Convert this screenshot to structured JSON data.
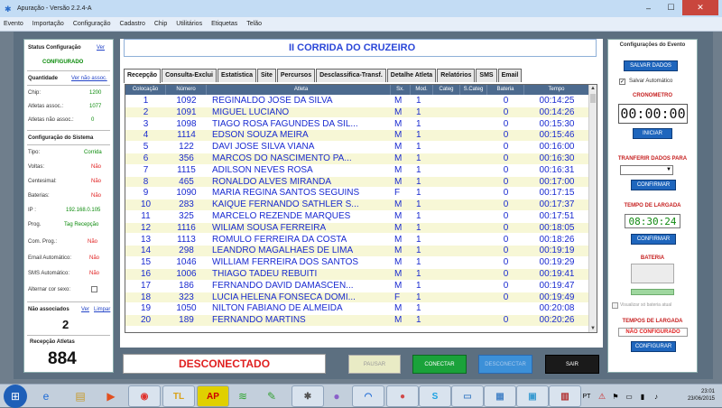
{
  "window": {
    "title": "Apuração - Versão 2.2.4-A",
    "minimize": "–",
    "maximize": "☐",
    "close": "✕"
  },
  "menu": [
    "Evento",
    "Importação",
    "Configuração",
    "Cadastro",
    "Chip",
    "Utilitários",
    "Etiquetas",
    "Telão"
  ],
  "left": {
    "status_config_label": "Status Configuração",
    "status_config_link": "Ver",
    "status_config_value": "CONFIGURADO",
    "quantidade_label": "Quantidade",
    "quantidade_link": "Ver não assoc.",
    "chip_label": "Chip:",
    "chip_value": "1200",
    "atletas_assoc_label": "Atletas assoc.:",
    "atletas_assoc_value": "1077",
    "atletas_nao_assoc_label": "Atletas não assoc.:",
    "atletas_nao_assoc_value": "0",
    "config_sistema_label": "Configuração do Sistema",
    "tipo_label": "Tipo:",
    "tipo_value": "Corrida",
    "voltas_label": "Voltas:",
    "voltas_value": "Não",
    "centesimal_label": "Centesimal:",
    "centesimal_value": "Não",
    "baterias_label": "Baterias:",
    "baterias_value": "Não",
    "ip_label": "IP :",
    "ip_value": "192.168.0.105",
    "prog_label": "Prog.",
    "prog_value": "Tag Recepção",
    "com_prog_label": "Com. Prog.:",
    "com_prog_value": "Não",
    "email_auto_label": "Email Automático:",
    "email_auto_value": "Não",
    "sms_auto_label": "SMS Automático:",
    "sms_auto_value": "Não",
    "alternar_label": "Alternar cor sexo:",
    "nao_assoc_label": "Não associados",
    "nao_assoc_link_ver": "Ver",
    "nao_assoc_link_limpar": "Limpar",
    "nao_assoc_value": "2",
    "recepcao_label": "Recepção Atletas",
    "recepcao_value": "884"
  },
  "event_title": "II CORRIDA DO CRUZEIRO",
  "tabs": [
    "Recepção",
    "Consulta-Exclui",
    "Estatística",
    "Site",
    "Percursos",
    "Desclassifica-Transf.",
    "Detalhe Atleta",
    "Relatórios",
    "SMS",
    "Email"
  ],
  "table": {
    "columns": [
      "Colocação",
      "Número",
      "Atleta",
      "Sx.",
      "Mod.",
      "Categ",
      "S.Categ",
      "Bateria",
      "Tempo"
    ],
    "rows": [
      [
        "1",
        "1092",
        "REGINALDO JOSE  DA SILVA",
        "M",
        "1",
        "",
        "",
        "0",
        "00:14:25"
      ],
      [
        "2",
        "1091",
        "MIGUEL LUCIANO",
        "M",
        "1",
        "",
        "",
        "0",
        "00:14:26"
      ],
      [
        "3",
        "1098",
        "TIAGO ROSA FAGUNDES DA SIL...",
        "M",
        "1",
        "",
        "",
        "0",
        "00:15:30"
      ],
      [
        "4",
        "1114",
        "EDSON SOUZA MEIRA",
        "M",
        "1",
        "",
        "",
        "0",
        "00:15:46"
      ],
      [
        "5",
        "122",
        "DAVI JOSE SILVA VIANA",
        "M",
        "1",
        "",
        "",
        "0",
        "00:16:00"
      ],
      [
        "6",
        "356",
        "MARCOS  DO NASCIMENTO PA...",
        "M",
        "1",
        "",
        "",
        "0",
        "00:16:30"
      ],
      [
        "7",
        "1115",
        "ADILSON NEVES ROSA",
        "M",
        "1",
        "",
        "",
        "0",
        "00:16:31"
      ],
      [
        "8",
        "465",
        "RONALDO ALVES MIRANDA",
        "M",
        "1",
        "",
        "",
        "0",
        "00:17:00"
      ],
      [
        "9",
        "1090",
        "MARIA REGINA SANTOS SEGUINS",
        "F",
        "1",
        "",
        "",
        "0",
        "00:17:15"
      ],
      [
        "10",
        "283",
        "KAIQUE  FERNANDO SATHLER S...",
        "M",
        "1",
        "",
        "",
        "0",
        "00:17:37"
      ],
      [
        "11",
        "325",
        "MARCELO REZENDE MARQUES",
        "M",
        "1",
        "",
        "",
        "0",
        "00:17:51"
      ],
      [
        "12",
        "1116",
        "WILIAM SOUSA FERREIRA",
        "M",
        "1",
        "",
        "",
        "0",
        "00:18:05"
      ],
      [
        "13",
        "1113",
        "ROMULO FERREIRA DA COSTA",
        "M",
        "1",
        "",
        "",
        "0",
        "00:18:26"
      ],
      [
        "14",
        "298",
        "LEANDRO MAGALHAES DE LIMA",
        "M",
        "1",
        "",
        "",
        "0",
        "00:19:19"
      ],
      [
        "15",
        "1046",
        "WILLIAM FERREIRA DOS SANTOS",
        "M",
        "1",
        "",
        "",
        "0",
        "00:19:29"
      ],
      [
        "16",
        "1006",
        "THIAGO TADEU REBUITI",
        "M",
        "1",
        "",
        "",
        "0",
        "00:19:41"
      ],
      [
        "17",
        "186",
        "FERNANDO  DAVID DAMASCEN...",
        "M",
        "1",
        "",
        "",
        "0",
        "00:19:47"
      ],
      [
        "18",
        "323",
        "LUCIA HELENA FONSECA DOMI...",
        "F",
        "1",
        "",
        "",
        "0",
        "00:19:49"
      ],
      [
        "19",
        "1050",
        "NILTON FABIANO DE ALMEIDA",
        "M",
        "1",
        "",
        "",
        "",
        "00:20:08"
      ],
      [
        "20",
        "189",
        "FERNANDO MARTINS",
        "M",
        "1",
        "",
        "",
        "0",
        "00:20:26"
      ]
    ]
  },
  "bottom": {
    "status": "DESCONECTADO",
    "pausar": "PAUSAR",
    "conectar": "CONECTAR",
    "desconectar": "DESCONECTAR",
    "sair": "SAIR"
  },
  "right": {
    "config_evento": "Configurações do Evento",
    "salvar_dados": "SALVAR DADOS",
    "salvar_auto": "Salvar Automático",
    "cronometro": "CRONOMETRO",
    "crono_value": "00:00:00",
    "iniciar": "INICIAR",
    "transferir": "TRANFERIR DADOS PARA",
    "confirmar1": "CONFIRMAR",
    "tempo_largada": "TEMPO DE LARGADA",
    "tempo_largada_value": "08:30:24",
    "confirmar2": "CONFIRMAR",
    "bateria": "BATERIA",
    "visualizar_bateria": "Visualizar só bateria atual",
    "tempos_largada": "TEMPOS DE LARGADA",
    "nao_configurado": "NÃO CONFIGURADO",
    "configurar": "CONFIGURAR"
  },
  "taskbar": {
    "start_icon": "windows-start-icon",
    "tl": "TL",
    "ap": "AP",
    "lang": "PT",
    "time": "23:01",
    "date": "23/06/2015"
  }
}
